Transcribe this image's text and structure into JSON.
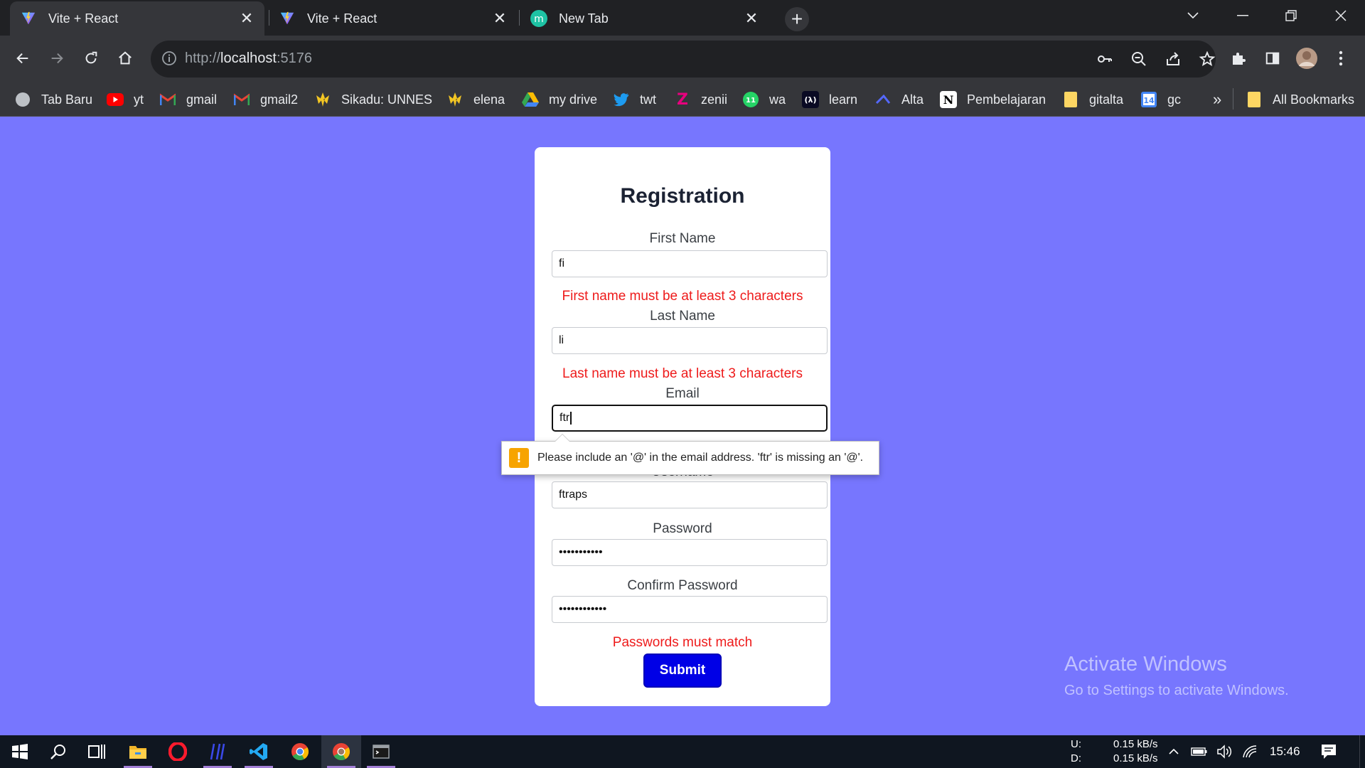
{
  "browser": {
    "tabs": [
      {
        "title": "Vite + React",
        "active": true
      },
      {
        "title": "Vite + React",
        "active": false
      },
      {
        "title": "New Tab",
        "active": false
      }
    ],
    "url_prefix": "http://",
    "url_host": "localhost",
    "url_port": ":5176"
  },
  "bookmarks": [
    {
      "label": "Tab Baru",
      "icon": "globe-icon"
    },
    {
      "label": "yt",
      "icon": "youtube-icon"
    },
    {
      "label": "gmail",
      "icon": "gmail-icon"
    },
    {
      "label": "gmail2",
      "icon": "gmail-icon"
    },
    {
      "label": "Sikadu: UNNES",
      "icon": "unnes-icon"
    },
    {
      "label": "elena",
      "icon": "unnes-icon"
    },
    {
      "label": "my drive",
      "icon": "drive-icon"
    },
    {
      "label": "twt",
      "icon": "twitter-icon"
    },
    {
      "label": "zenii",
      "icon": "zenius-icon"
    },
    {
      "label": "wa",
      "icon": "whatsapp-icon"
    },
    {
      "label": "learn",
      "icon": "freecodecamp-icon"
    },
    {
      "label": "Alta",
      "icon": "alta-icon"
    },
    {
      "label": "Pembelajaran",
      "icon": "notion-icon"
    },
    {
      "label": "gitalta",
      "icon": "folder-icon"
    },
    {
      "label": "gc",
      "icon": "calendar-icon"
    }
  ],
  "bookmarks_overflow": "»",
  "all_bookmarks": "All Bookmarks",
  "form": {
    "title": "Registration",
    "first_name_label": "First Name",
    "first_name_value": "fi",
    "first_name_error": "First name must be at least 3 characters",
    "last_name_label": "Last Name",
    "last_name_value": "li",
    "last_name_error": "Last name must be at least 3 characters",
    "email_label": "Email",
    "email_value": "ftr",
    "username_label": "Username",
    "username_value": "ftraps",
    "password_label": "Password",
    "password_value": "•••••••••••",
    "confirm_label": "Confirm Password",
    "confirm_value": "••••••••••••",
    "confirm_error": "Passwords must match",
    "submit_label": "Submit"
  },
  "validation_tooltip": "Please include an '@' in the email address. 'ftr' is missing an '@'.",
  "watermark": {
    "line1": "Activate Windows",
    "line2": "Go to Settings to activate Windows."
  },
  "taskbar": {
    "upload_label": "U:",
    "download_label": "D:",
    "upload_speed": "0.15 kB/s",
    "download_speed": "0.15 kB/s",
    "time": "15:46"
  },
  "colors": {
    "page_background": "#7776fe",
    "error_text": "#ee1b1b",
    "submit_button": "#0000e6",
    "chrome_dark": "#202124"
  }
}
